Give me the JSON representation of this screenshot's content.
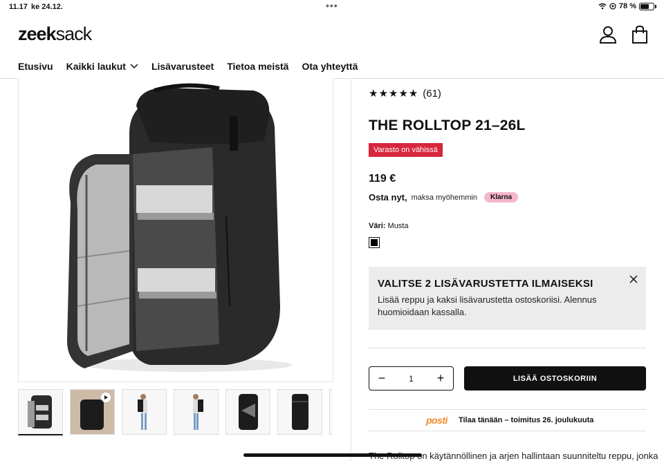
{
  "status_bar": {
    "time": "11.17",
    "date": "ke 24.12.",
    "battery_text": "78 %",
    "battery_level": 0.78,
    "menu_dots": "•••"
  },
  "header": {
    "logo_bold": "zeek",
    "logo_rest": "sack"
  },
  "nav": {
    "items": [
      "Etusivu",
      "Kaikki laukut",
      "Lisävarusteet",
      "Tietoa meistä",
      "Ota yhteyttä"
    ]
  },
  "product": {
    "rating_stars": "★★★★★",
    "rating_count": "(61)",
    "title": "THE ROLLTOP 21–26L",
    "stock_badge": "Varasto on vähissä",
    "price": "119 €",
    "pay_bold": "Osta nyt,",
    "pay_small": "maksa myöhemmin",
    "klarna_label": "Klarna",
    "color_label": "Väri:",
    "color_value": "Musta",
    "swatch_color": "#000000"
  },
  "promo": {
    "title": "VALITSE 2 LISÄVARUSTETTA ILMAISEKSI",
    "text": "Lisää reppu ja kaksi lisävarustetta ostoskoriisi. Alennus huomioidaan kassalla."
  },
  "cart": {
    "minus": "−",
    "quantity": "1",
    "plus": "+",
    "add_label": "LISÄÄ OSTOSKORIIN"
  },
  "shipping": {
    "carrier": "posti",
    "text": "Tilaa tänään – toimitus 26. joulukuuta"
  },
  "description": {
    "text": "The Rolltop on käytännöllinen ja arjen hallintaan suunniteltu reppu, jonka"
  },
  "gallery": {
    "thumb_count": 7,
    "video_thumb_index": 1
  },
  "colors": {
    "badge_red": "#d7263d",
    "klarna_pink": "#f5b6c9",
    "promo_bg": "#ececec",
    "posti_orange": "#f08a24"
  }
}
